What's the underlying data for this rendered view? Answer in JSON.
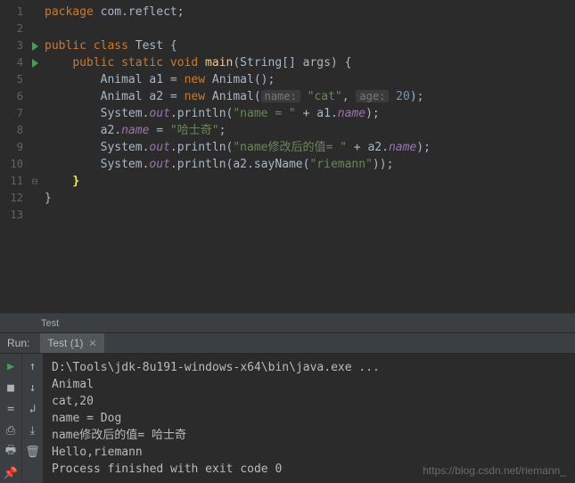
{
  "gutter_lines": [
    "1",
    "2",
    "3",
    "4",
    "5",
    "6",
    "7",
    "8",
    "9",
    "10",
    "11",
    "12",
    "13"
  ],
  "run_markers_at": [
    3,
    4
  ],
  "tokens": {
    "pkg": "package",
    "pkgname": "com.reflect",
    "public": "public",
    "class": "class",
    "Test": "Test",
    "static": "static",
    "void": "void",
    "main": "main",
    "params": "(String[] args)",
    "new": "new",
    "Animal": "Animal",
    "a1": "a1",
    "a2": "a2",
    "nameParam": "name:",
    "catStr": "\"cat\"",
    "ageParam": "age:",
    "twenty": "20",
    "System": "System",
    "out": "out",
    "println": "println",
    "nameEq": "\"name = \"",
    "name": "name",
    "haskyStr": "\"哈士奇\"",
    "modStr": "\"name修改后的值= \"",
    "sayName": "sayName",
    "riemannStr": "\"riemann\""
  },
  "breadcrumbs": "Test",
  "run": {
    "label": "Run:",
    "tab": "Test (1)"
  },
  "console_lines": [
    "D:\\Tools\\jdk-8u191-windows-x64\\bin\\java.exe ...",
    "Animal",
    "cat,20",
    "name = Dog",
    "name修改后的值= 哈士奇",
    "Hello,riemann",
    "",
    "Process finished with exit code 0",
    ""
  ],
  "watermark": "https://blog.csdn.net/riemann_"
}
